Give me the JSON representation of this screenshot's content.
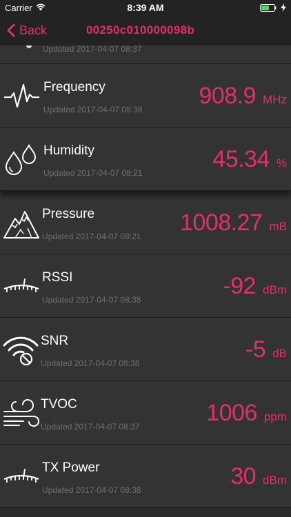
{
  "status_bar": {
    "carrier": "Carrier",
    "time": "8:39 AM"
  },
  "nav": {
    "back_label": "Back",
    "title": "00250c010000098b"
  },
  "colors": {
    "accent": "#e0306a",
    "background": "#2b2b2d",
    "row_background": "#333335",
    "muted_text": "#707072"
  },
  "partial_row": {
    "updated": "Updated 2017-04-07 08:37"
  },
  "sensors": [
    {
      "name": "Frequency",
      "icon": "pulse-icon",
      "updated": "Updated 2017-04-07 08:38",
      "value": "908.9",
      "unit": "MHz"
    },
    {
      "name": "Humidity",
      "icon": "water-drops-icon",
      "updated": "Updated 2017-04-07 08:21",
      "value": "45.34",
      "unit": "%"
    },
    {
      "name": "Pressure",
      "icon": "mountain-icon",
      "updated": "Updated 2017-04-07 08:21",
      "value": "1008.27",
      "unit": "mB"
    },
    {
      "name": "RSSI",
      "icon": "signal-gauge-icon",
      "updated": "Updated 2017-04-07 08:38",
      "value": "-92",
      "unit": "dBm"
    },
    {
      "name": "SNR",
      "icon": "wifi-blocked-icon",
      "updated": "Updated 2017-04-07 08:38",
      "value": "-5",
      "unit": "dB"
    },
    {
      "name": "TVOC",
      "icon": "wind-icon",
      "updated": "Updated 2017-04-07 08:37",
      "value": "1006",
      "unit": "ppm"
    },
    {
      "name": "TX Power",
      "icon": "signal-gauge-icon",
      "updated": "Updated 2017-04-07 08:38",
      "value": "30",
      "unit": "dBm"
    }
  ]
}
